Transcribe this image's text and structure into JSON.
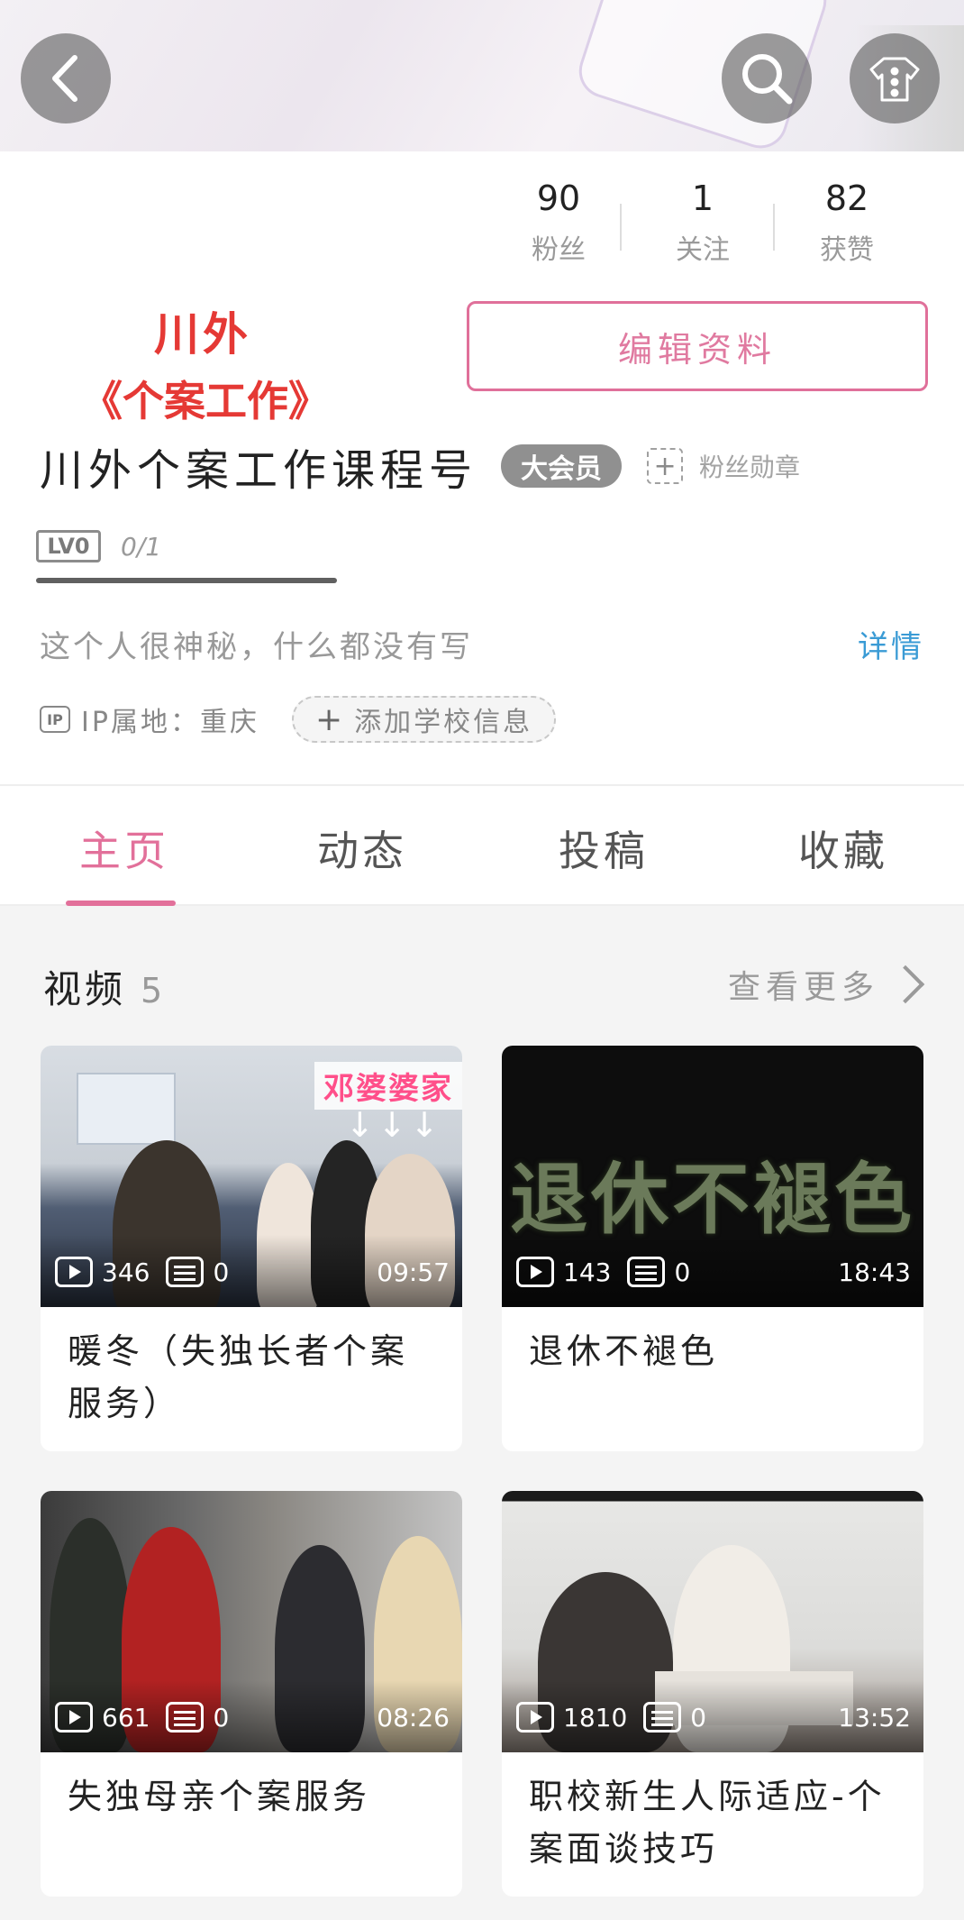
{
  "header": {
    "back_icon": "chevron-left-icon",
    "search_icon": "search-icon",
    "more_icon": "more-vertical-icon"
  },
  "avatar": {
    "line1": "川外",
    "line2": "《个案工作》",
    "colors": {
      "text": "#e53935"
    }
  },
  "stats": [
    {
      "value": "90",
      "label": "粉丝"
    },
    {
      "value": "1",
      "label": "关注"
    },
    {
      "value": "82",
      "label": "获赞"
    }
  ],
  "edit_button": "编辑资料",
  "profile": {
    "name": "川外个案工作课程号",
    "vip_badge": "大会员",
    "fan_medal": "粉丝勋章",
    "level_badge": "LV0",
    "level_progress": "0/1",
    "bio": "这个人很神秘，什么都没有写",
    "detail_link": "详情",
    "ip_icon": "IP",
    "ip_location": "IP属地：重庆",
    "add_school": "添加学校信息"
  },
  "tabs": [
    {
      "label": "主页",
      "active": true
    },
    {
      "label": "动态",
      "active": false
    },
    {
      "label": "投稿",
      "active": false
    },
    {
      "label": "收藏",
      "active": false
    }
  ],
  "videos_section": {
    "title": "视频",
    "count": "5",
    "see_more": "查看更多"
  },
  "videos": [
    {
      "title": "暖冬（失独长者个案服务）",
      "plays": "346",
      "danmaku": "0",
      "duration": "09:57",
      "thumb_tag": "邓婆婆家",
      "thumb_arrows": "↓↓↓"
    },
    {
      "title": "退休不褪色",
      "plays": "143",
      "danmaku": "0",
      "duration": "18:43",
      "thumb_text": "退休不褪色"
    },
    {
      "title": "失独母亲个案服务",
      "plays": "661",
      "danmaku": "0",
      "duration": "08:26"
    },
    {
      "title": "职校新生人际适应-个案面谈技巧",
      "plays": "1810",
      "danmaku": "0",
      "duration": "13:52"
    }
  ],
  "colors": {
    "accent": "#e2709a",
    "link": "#3a9bd5"
  }
}
